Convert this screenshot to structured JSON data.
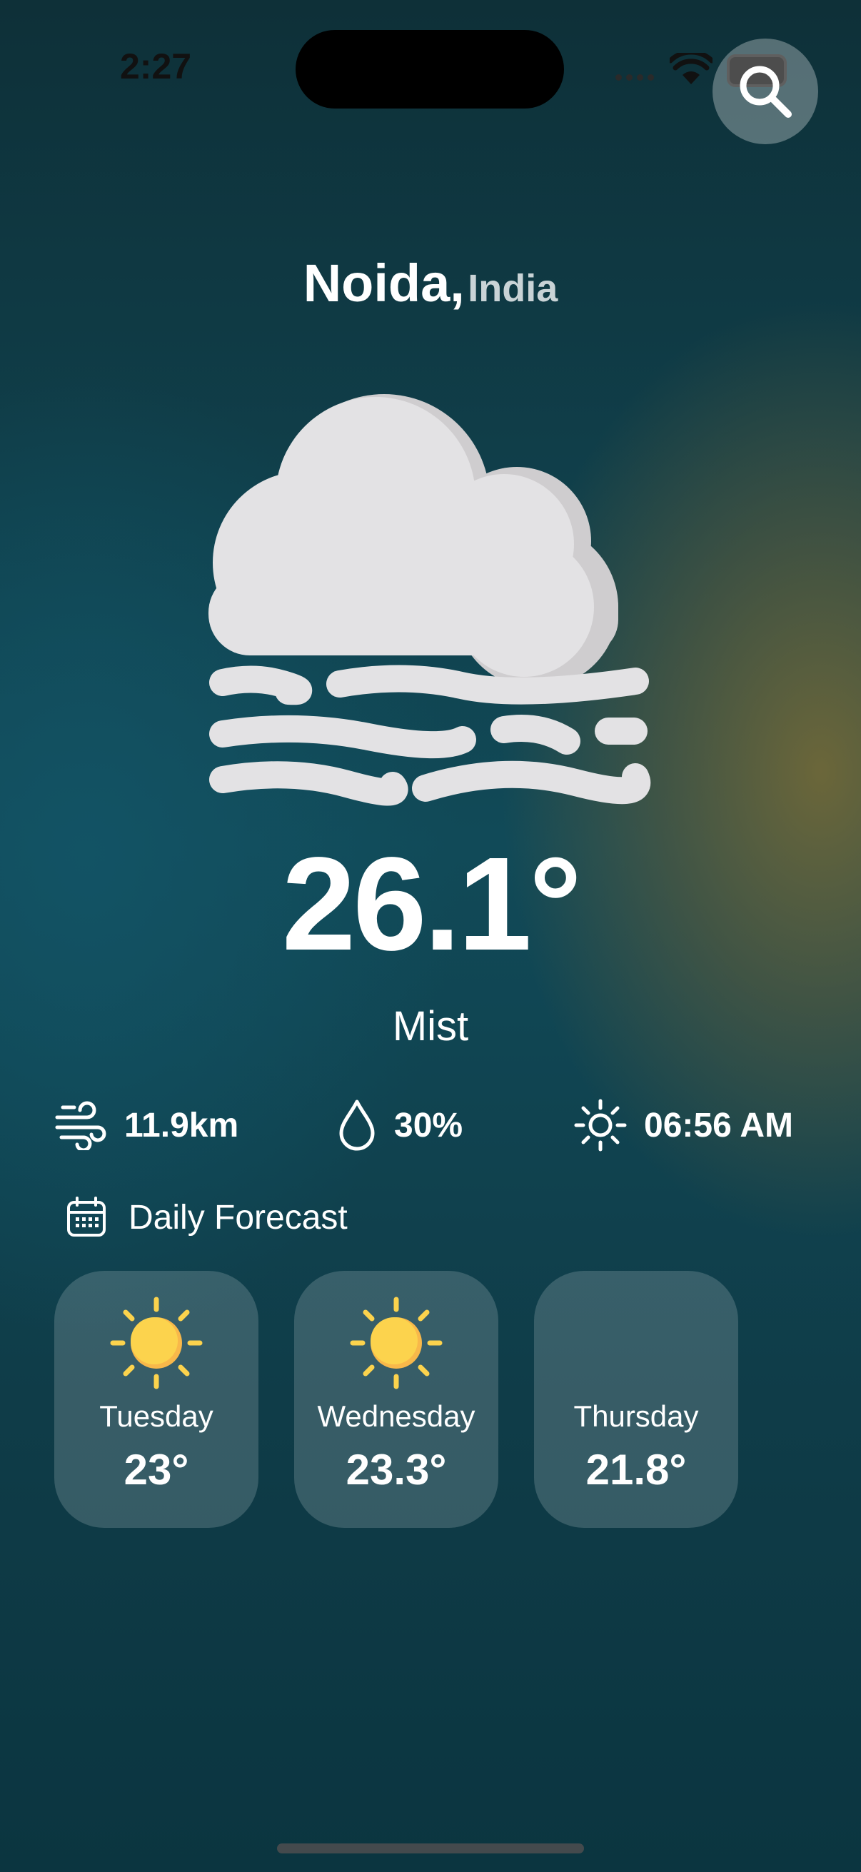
{
  "status_bar": {
    "time": "2:27"
  },
  "location": {
    "city": "Noida,",
    "country": "India"
  },
  "current": {
    "temperature": "26.1°",
    "condition": "Mist",
    "icon": "mist-cloud-icon"
  },
  "stats": {
    "wind": {
      "value": "11.9km",
      "icon": "wind-icon"
    },
    "humidity": {
      "value": "30%",
      "icon": "droplet-icon"
    },
    "sunrise": {
      "value": "06:56 AM",
      "icon": "sun-icon"
    }
  },
  "forecast": {
    "title": "Daily Forecast",
    "days": [
      {
        "day": "Tuesday",
        "temp": "23°",
        "icon": "sun-icon"
      },
      {
        "day": "Wednesday",
        "temp": "23.3°",
        "icon": "sun-icon"
      },
      {
        "day": "Thursday",
        "temp": "21.8°",
        "icon": "none"
      }
    ]
  },
  "colors": {
    "accent_sun": "#fcd34d",
    "cloud": "#e3e2e4",
    "text": "#ffffff"
  }
}
